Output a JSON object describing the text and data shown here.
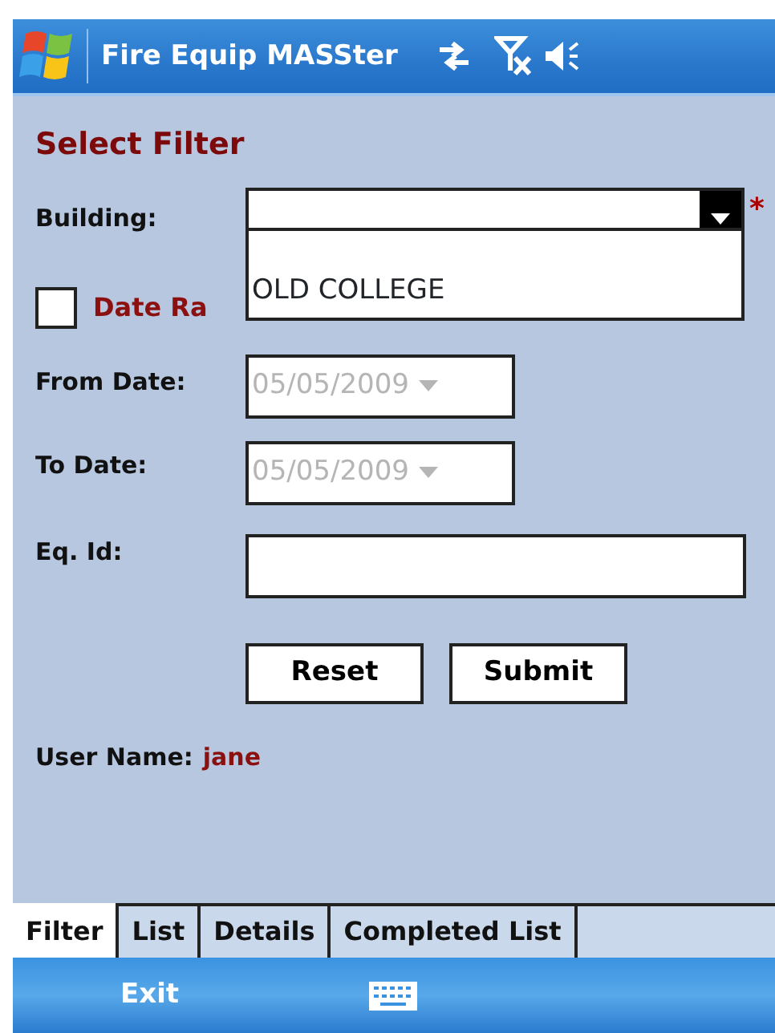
{
  "title_bar": {
    "title": "Fire Equip MASSter"
  },
  "form": {
    "heading": "Select Filter",
    "building": {
      "label": "Building:",
      "expanded": true,
      "required_mark": "*",
      "options": [
        {
          "label": "OLD COLLEGE"
        }
      ]
    },
    "date_range": {
      "label": "Date Ra",
      "checked": false
    },
    "from_date": {
      "label": "From Date:",
      "value": "05/05/2009",
      "disabled": true
    },
    "to_date": {
      "label": "To Date:",
      "value": "05/05/2009",
      "disabled": true
    },
    "eq_id": {
      "label": "Eq. Id:"
    },
    "buttons": [
      "Reset",
      "Submit"
    ],
    "user": {
      "label": "User Name:",
      "value": "jane"
    }
  },
  "tabs": [
    {
      "label": "Filter",
      "selected": true
    },
    {
      "label": "List",
      "selected": false
    },
    {
      "label": "Details",
      "selected": false
    },
    {
      "label": "Completed List",
      "selected": false
    }
  ],
  "menu_bar": {
    "left": "Exit"
  }
}
